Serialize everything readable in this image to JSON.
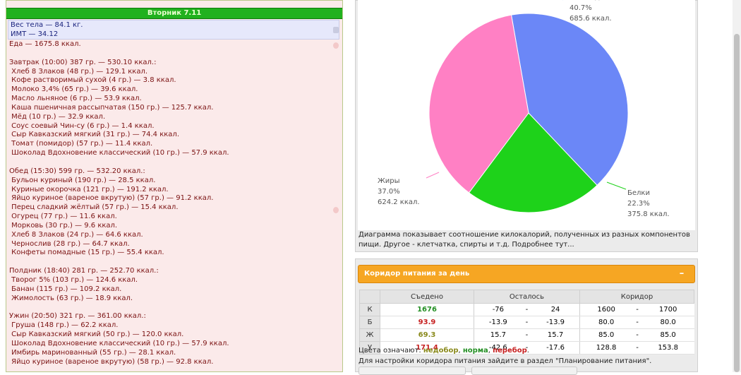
{
  "day": {
    "title": "Вторник 7.11"
  },
  "body": {
    "weight": "Вес тела — 84.1 кг.",
    "bmi": "ИМТ — 34.12"
  },
  "food_total": "Еда — 1675.8 ккал.",
  "meals": [
    {
      "title": "Завтрак (10:00) 387 гр. — 530.10 ккал.:",
      "items": [
        " Хлеб 8 Злаков (48 гр.) — 129.1 ккал.",
        " Кофе растворимый сухой (4 гр.) — 3.8 ккал.",
        " Молоко 3,4% (65 гр.) — 39.6 ккал.",
        " Масло льняное (6 гр.) — 53.9 ккал.",
        " Каша пшеничная рассыпчатая (150 гр.) — 125.7 ккал.",
        " Мёд (10 гр.) — 32.9 ккал.",
        " Соус соевый Чин-су (6 гр.) — 1.4 ккал.",
        " Сыр Кавказский мягкий (31 гр.) — 74.4 ккал.",
        " Томат (помидор) (57 гр.) — 11.4 ккал.",
        " Шоколад Вдохновение классический (10 гр.) — 57.9 ккал."
      ]
    },
    {
      "title": "Обед (15:30) 599 гр. — 532.20 ккал.:",
      "items": [
        " Бульон куриный (190 гр.) — 28.5 ккал.",
        " Куриные окорочка (121 гр.) — 191.2 ккал.",
        " Яйцо куриное (вареное вкрутую) (57 гр.) — 91.2 ккал.",
        " Перец сладкий жёлтый (57 гр.) — 15.4 ккал.",
        " Огурец (77 гр.) — 11.6 ккал.",
        " Морковь (30 гр.) — 9.6 ккал.",
        " Хлеб 8 Злаков (24 гр.) — 64.6 ккал.",
        " Чернослив (28 гр.) — 64.7 ккал.",
        " Конфеты помадные (15 гр.) — 55.4 ккал."
      ]
    },
    {
      "title": "Полдник (18:40) 281 гр. — 252.70 ккал.:",
      "items": [
        " Творог 5% (103 гр.) — 124.6 ккал.",
        " Банан (115 гр.) — 109.2 ккал.",
        " Жимолость (63 гр.) — 18.9 ккал."
      ]
    },
    {
      "title": "Ужин (20:50) 321 гр. — 361.00 ккал.:",
      "items": [
        " Груша (148 гр.) — 62.2 ккал.",
        " Сыр Кавказский мягкий (50 гр.) — 120.0 ккал.",
        " Шоколад Вдохновение классический (10 гр.) — 57.9 ккал.",
        " Имбирь маринованный (55 гр.) — 28.1 ккал.",
        " Яйцо куриное (вареное вкрутую) (58 гр.) — 92.8 ккал."
      ]
    }
  ],
  "chart_data": {
    "type": "pie",
    "slices": [
      {
        "label": "Углеводы",
        "percent": "40.7%",
        "kcal": "685.6 ккал.",
        "value": 40.7,
        "color": "#6b87f7"
      },
      {
        "label": "Белки",
        "percent": "22.3%",
        "kcal": "375.8 ккал.",
        "value": 22.3,
        "color": "#1ed21a"
      },
      {
        "label": "Жиры",
        "percent": "37.0%",
        "kcal": "624.2 ккал.",
        "value": 37.0,
        "color": "#ff80c4"
      }
    ]
  },
  "chart_caption": "Диаграмма показывает соотношение килокалорий, полученных из разных компонентов пищи. Другое - клетчатка, спирты и т.д. Подробнее тут...",
  "corridor": {
    "title": "Коридор питания за день",
    "collapse": "–",
    "headers": {
      "eaten": "Съедено",
      "left": "Осталось",
      "range": "Коридор"
    },
    "rows": [
      {
        "label": "К",
        "eaten": "1676",
        "eaten_color": "#238f23",
        "left_min": "-76",
        "left_max": "24",
        "range_min": "1600",
        "range_max": "1700"
      },
      {
        "label": "Б",
        "eaten": "93.9",
        "eaten_color": "#c62020",
        "left_min": "-13.9",
        "left_max": "-13.9",
        "range_min": "80.0",
        "range_max": "80.0"
      },
      {
        "label": "Ж",
        "eaten": "69.3",
        "eaten_color": "#8a8a1c",
        "left_min": "15.7",
        "left_max": "15.7",
        "range_min": "85.0",
        "range_max": "85.0"
      },
      {
        "label": "У",
        "eaten": "171.4",
        "eaten_color": "#c62020",
        "left_min": "-42.6",
        "left_max": "-17.6",
        "range_min": "128.8",
        "range_max": "153.8"
      }
    ],
    "dash": "-",
    "legend_prefix": "Цвета означают: ",
    "legend_under": "недобор",
    "legend_norm": "норма",
    "legend_over": "перебор",
    "legend_under_color": "#8a8a1c",
    "legend_norm_color": "#238f23",
    "legend_over_color": "#c62020",
    "settings_text": "Для настройки коридора питания зайдите в раздел \"Планирование питания\"."
  }
}
